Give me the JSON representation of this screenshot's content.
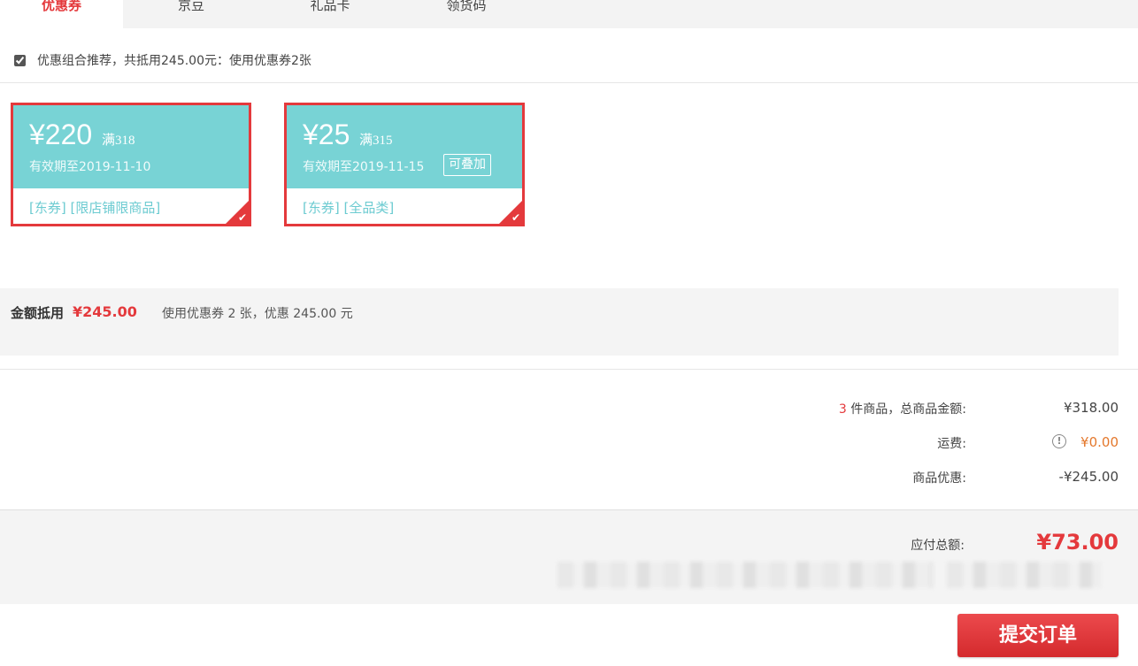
{
  "tabs": [
    {
      "label": "优惠券",
      "active": true
    },
    {
      "label": "京豆",
      "active": false
    },
    {
      "label": "礼品卡",
      "active": false
    },
    {
      "label": "领货码",
      "active": false
    }
  ],
  "combo": {
    "checked": true,
    "text": "优惠组合推荐，共抵用245.00元：使用优惠券2张"
  },
  "coupons": [
    {
      "amount": "¥220",
      "condition": "满318",
      "validity": "有效期至2019-11-10",
      "tags": "[东券] [限店铺限商品]",
      "badge": "",
      "selected": true
    },
    {
      "amount": "¥25",
      "condition": "满315",
      "validity": "有效期至2019-11-15",
      "tags": "[东券] [全品类]",
      "badge": "可叠加",
      "selected": true
    }
  ],
  "deduction": {
    "label": "金额抵用",
    "value": "¥245.00",
    "desc": "使用优惠券 2 张，优惠 245.00 元"
  },
  "summary": {
    "count": "3",
    "goods_label": "件商品，总商品金额:",
    "goods_value": "¥318.00",
    "shipping_label": "运费:",
    "shipping_value": "¥0.00",
    "discount_label": "商品优惠:",
    "discount_value": "-¥245.00"
  },
  "total": {
    "label": "应付总额:",
    "value": "¥73.00"
  },
  "submit_label": "提交订单",
  "icons": {
    "check": "check-icon",
    "info": "info-icon"
  },
  "colors": {
    "accent": "#e4393c",
    "coupon_bg": "#78d3d5",
    "tag_text": "#6ccbd1",
    "shipping": "#e4782c"
  }
}
